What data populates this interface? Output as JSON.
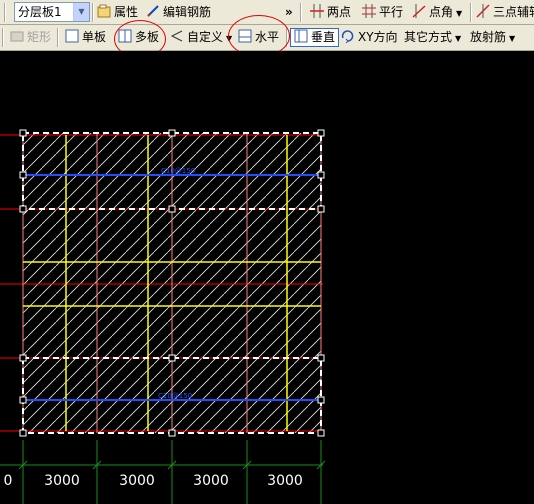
{
  "toolbar1": {
    "layer_select": "分层板1",
    "properties": "属性",
    "edit_rebar": "编辑钢筋",
    "overflow": "»",
    "two_point": "两点",
    "parallel": "平行",
    "point_angle": "点角",
    "three_point": "三点辅轴"
  },
  "toolbar2": {
    "rect": "矩形",
    "single_slab": "单板",
    "multi_slab": "多板",
    "custom": "自定义",
    "horizontal": "水平",
    "vertical": "垂直",
    "xy_direction": "XY方向",
    "other_methods": "其它方式",
    "radial_rebar": "放射筋"
  },
  "drawing": {
    "rebar_label_top": "C10@150",
    "rebar_label_bottom": "C10@150",
    "dimensions": [
      "3000",
      "3000",
      "3000",
      "3000"
    ],
    "colors": {
      "background": "#000000",
      "grid_red": "#ff0000",
      "yellow_beam": "#ffff00",
      "blue_rebar": "#1e50ff",
      "hatch": "#e8e8e8",
      "dim_green": "#1e8c1e",
      "pink_grid": "#ff8080"
    }
  }
}
